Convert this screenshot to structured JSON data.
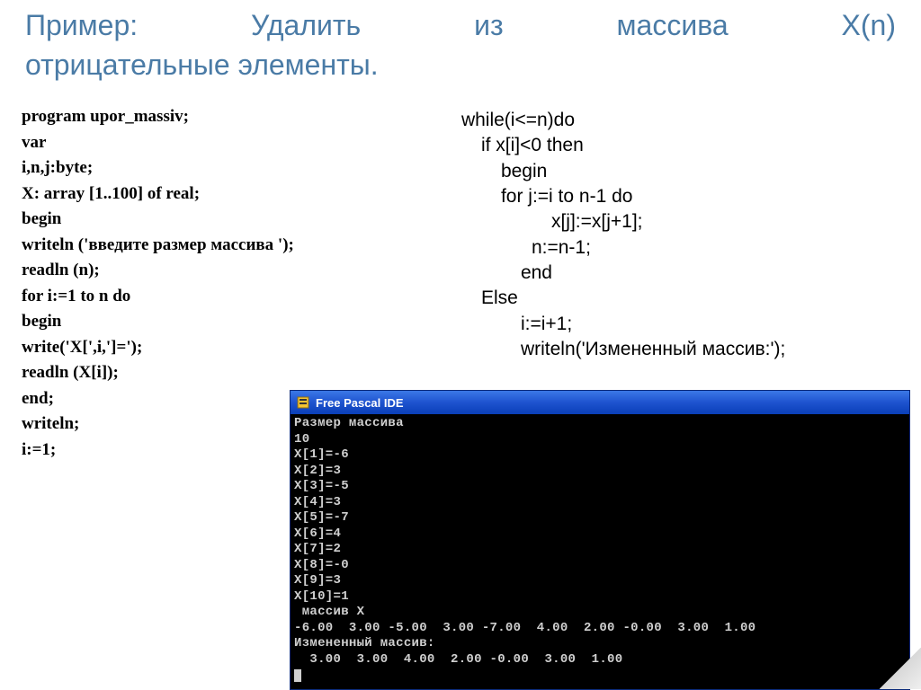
{
  "title_line1": "Пример:   Удалить    из    массива    X(n)",
  "title_line2": "отрицательные элементы.",
  "left_code": [
    "program upor_massiv;",
    "var",
    "i,n,j:byte;",
    "X: array [1..100] of real;",
    "begin",
    "writeln ('введите размер массива ');",
    "readln (n);",
    "for i:=1 to n do",
    "  begin",
    "   write('X[',i,']=');",
    "   readln (X[i]);",
    "end;",
    "writeln;",
    "i:=1;"
  ],
  "right_code": [
    {
      "cls": "l0",
      "t": "while(i<=n)do"
    },
    {
      "cls": "l1",
      "t": "if x[i]<0 then"
    },
    {
      "cls": "l2",
      "t": "begin"
    },
    {
      "cls": "l2",
      "t": " for j:=i to n-1 do"
    },
    {
      "cls": "l4",
      "t": "x[j]:=x[j+1];"
    },
    {
      "cls": "l3b",
      "t": "  n:=n-1;"
    },
    {
      "cls": "l3",
      "t": "end"
    },
    {
      "cls": "l1",
      "t": "Else"
    },
    {
      "cls": "l3",
      "t": "i:=i+1;"
    },
    {
      "cls": "l3",
      "t": "writeln('Измененный массив:');"
    }
  ],
  "console": {
    "title": "Free Pascal IDE",
    "lines": [
      "Размер массива",
      "10",
      "X[1]=-6",
      "X[2]=3",
      "X[3]=-5",
      "X[4]=3",
      "X[5]=-7",
      "X[6]=4",
      "X[7]=2",
      "X[8]=-0",
      "X[9]=3",
      "X[10]=1",
      " массив X",
      "-6.00  3.00 -5.00  3.00 -7.00  4.00  2.00 -0.00  3.00  1.00",
      "Измененный массив:",
      "  3.00  3.00  4.00  2.00 -0.00  3.00  1.00"
    ]
  }
}
